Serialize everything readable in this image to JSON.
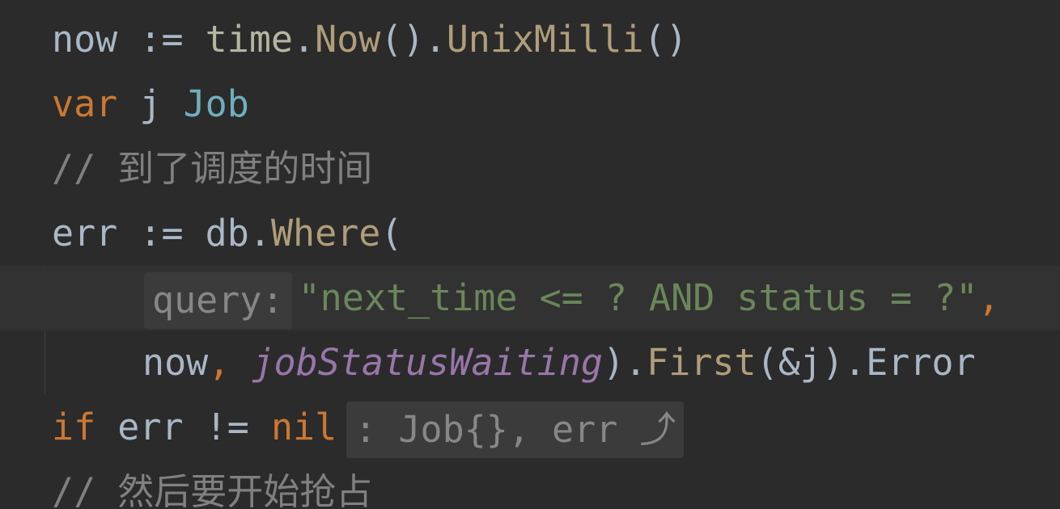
{
  "lines": [
    {
      "var_now": "now",
      "op_assign": " := ",
      "pkg_time": "time",
      "dot": ".",
      "fn_now": "Now",
      "parens": "()",
      "dot2": ".",
      "fn_unixmilli": "UnixMilli",
      "parens2": "()"
    },
    {
      "kw_var": "var",
      "ident_j": " j ",
      "type_job": "Job"
    },
    {
      "comment_slashes": "// ",
      "comment_text": "到了调度的时间"
    },
    {
      "var_err": "err",
      "op_assign": " := ",
      "ident_db": "db",
      "dot": ".",
      "fn_where": "Where",
      "open_paren": "("
    },
    {
      "param_hint": "query:",
      "string_literal": "\"next_time <= ? AND status = ?\"",
      "comma": ","
    },
    {
      "arg_now": "now",
      "comma": ", ",
      "const_status": "jobStatusWaiting",
      "close_paren_dot": ").",
      "fn_first": "First",
      "args_first": "(&j).",
      "field_error": "Error"
    },
    {
      "kw_if": "if",
      "cond_err": " err ",
      "op_neq": "!=",
      "space": " ",
      "kw_nil": "nil",
      "block_hint": ": Job{}, err ⤴"
    },
    {
      "comment_slashes": "// ",
      "comment_text": "然后要开始抢占"
    }
  ]
}
